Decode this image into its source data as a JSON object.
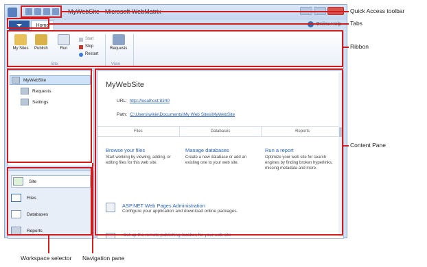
{
  "window": {
    "title": "MyWebSite - Microsoft WebMatrix",
    "tabs": {
      "file": "",
      "home": "Home"
    },
    "online_help": "Online Help"
  },
  "ribbon": {
    "buttons": [
      {
        "label": "My Sites",
        "icon": "folder-icon"
      },
      {
        "label": "Publish",
        "icon": "globe-icon"
      },
      {
        "label": "Run",
        "icon": "run-icon"
      }
    ],
    "stack": {
      "start": "Start",
      "stop": "Stop",
      "restart": "Restart"
    },
    "requests": "Requests",
    "groups": {
      "site": "Site",
      "view": "View"
    }
  },
  "navigation": {
    "items": [
      {
        "label": "MyWebSite",
        "selected": true
      },
      {
        "label": "Requests"
      },
      {
        "label": "Settings"
      }
    ]
  },
  "workspace_selector": {
    "items": [
      {
        "label": "Site",
        "selected": true
      },
      {
        "label": "Files"
      },
      {
        "label": "Databases"
      },
      {
        "label": "Reports"
      }
    ]
  },
  "content": {
    "site_title": "MyWebSite",
    "url_label": "URL:",
    "url": "http://localhost:8340",
    "path_label": "Path:",
    "path": "C:\\Users\\wikie\\Documents\\My Web Sites\\MyWebSite",
    "columns": [
      "Files",
      "Databases",
      "Reports"
    ],
    "cards": [
      {
        "heading": "Browse your files",
        "text": "Start working by viewing, adding, or editing files for this web site."
      },
      {
        "heading": "Manage databases",
        "text": "Create a new database or add an existing one to your web site."
      },
      {
        "heading": "Run a report",
        "text": "Optimize your web site for search engines by finding broken hyperlinks, missing metadata and more."
      }
    ],
    "admin": {
      "heading": "ASP.NET Web Pages Administration",
      "text": "Configure your application and download online packages."
    },
    "publish_link": "Set up the remote publishing location for your web site"
  },
  "callouts": {
    "qat": "Quick Access toolbar",
    "tabs": "Tabs",
    "ribbon": "Ribbon",
    "content_pane": "Content Pane",
    "workspace_selector": "Workspace selector",
    "navigation_pane": "Navigation pane"
  },
  "colors": {
    "highlight": "#d01c1c",
    "accent": "#2c5aa0",
    "link": "#2a63b5"
  }
}
